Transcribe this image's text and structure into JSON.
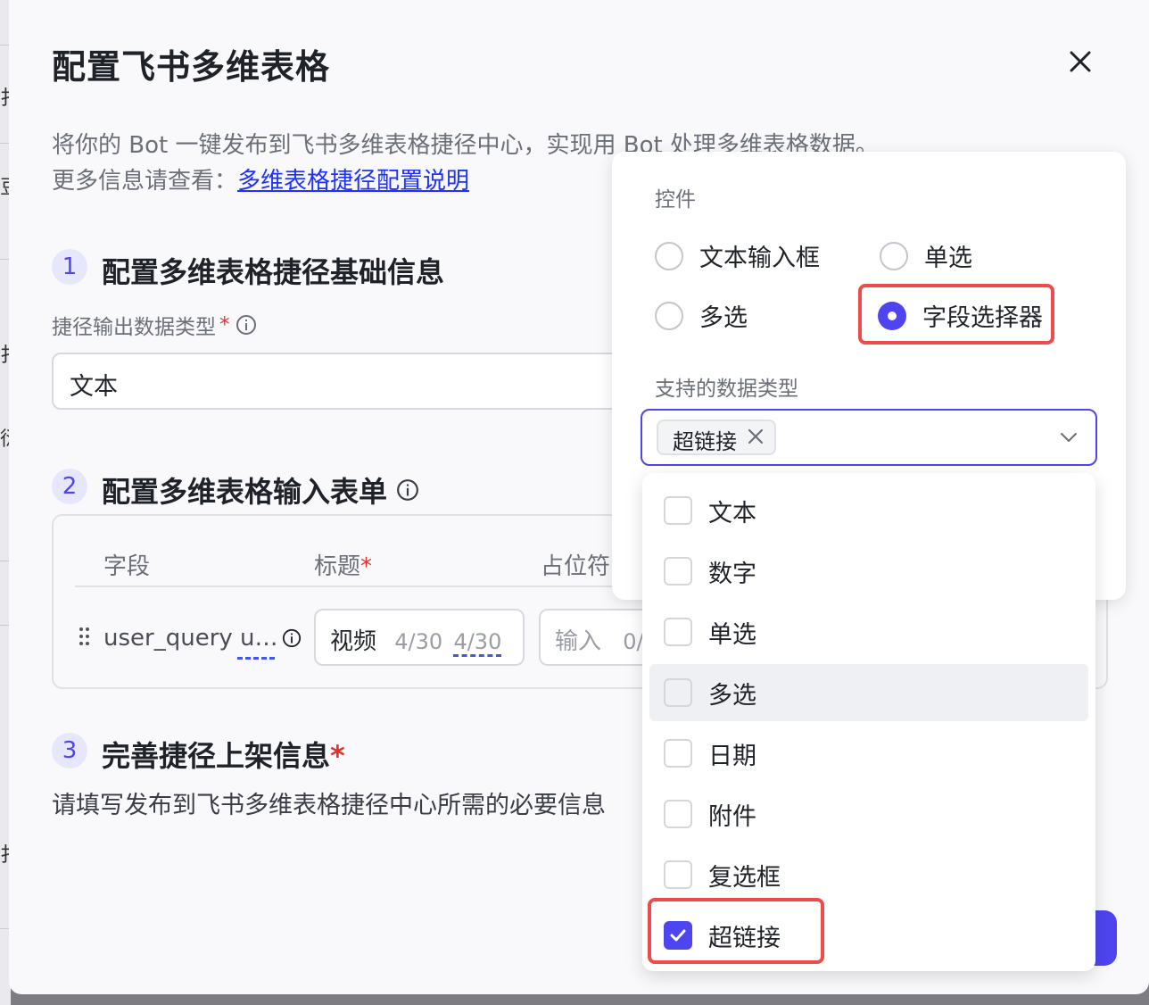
{
  "modal": {
    "title": "配置飞书多维表格",
    "desc_line1": "将你的 Bot 一键发布到飞书多维表格捷径中心，实现用 Bot 处理多维表格数据。",
    "desc_line2_prefix": "更多信息请查看：",
    "desc_link": "多维表格捷径配置说明"
  },
  "step1": {
    "num": "1",
    "title": "配置多维表格捷径基础信息",
    "field_label": "捷径输出数据类型",
    "required_mark": "*",
    "output_type_value": "文本"
  },
  "step2": {
    "num": "2",
    "title": "配置多维表格输入表单",
    "columns": {
      "field": "字段",
      "title": "标题",
      "title_required": "*",
      "placeholder": "占位符"
    },
    "row": {
      "field_name": "user_query u…",
      "title_value": "视频",
      "title_count_a": "4/30",
      "title_count_b": "4/30",
      "placeholder_hint": "输入",
      "placeholder_count": "0/"
    }
  },
  "step3": {
    "num": "3",
    "title": "完善捷径上架信息",
    "required_mark": "*",
    "desc": "请填写发布到飞书多维表格捷径中心所需的必要信息"
  },
  "popover": {
    "controls_label": "控件",
    "controls": [
      {
        "label": "文本输入框",
        "selected": false
      },
      {
        "label": "单选",
        "selected": false
      },
      {
        "label": "多选",
        "selected": false
      },
      {
        "label": "字段选择器",
        "selected": true
      }
    ],
    "data_types_label": "支持的数据类型",
    "selected_tag": "超链接"
  },
  "dropdown": {
    "options": [
      {
        "label": "文本",
        "checked": false
      },
      {
        "label": "数字",
        "checked": false
      },
      {
        "label": "单选",
        "checked": false
      },
      {
        "label": "多选",
        "checked": false,
        "hovered": true
      },
      {
        "label": "日期",
        "checked": false
      },
      {
        "label": "附件",
        "checked": false
      },
      {
        "label": "复选框",
        "checked": false
      },
      {
        "label": "超链接",
        "checked": true
      }
    ]
  },
  "background": {
    "left_glyphs": [
      "扌",
      "豆",
      "扌",
      "衍",
      "扌"
    ]
  },
  "colors": {
    "accent": "#4e45f0",
    "link": "#1d32ff",
    "highlight_box": "#ef4b4b",
    "required": "#e5312d"
  },
  "icons": [
    "close-icon",
    "info-icon",
    "drag-handle-icon",
    "chevron-down-icon",
    "tag-remove-icon",
    "checkmark-icon"
  ]
}
